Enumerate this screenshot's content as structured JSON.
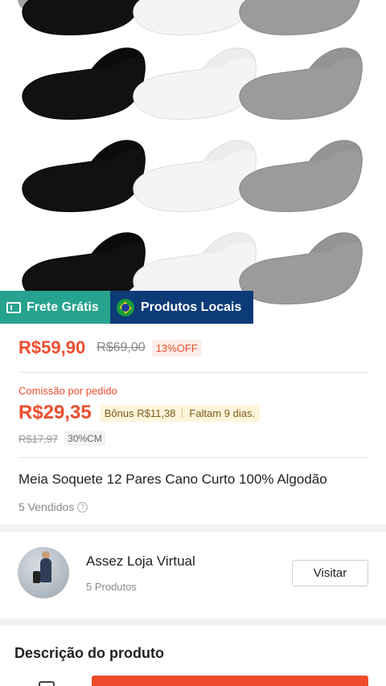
{
  "product": {
    "badges": {
      "free_shipping": "Frete Grátis",
      "local_products": "Produtos Locais"
    },
    "price": "R$59,90",
    "original_price": "R$69,00",
    "discount": "13%OFF",
    "commission": {
      "label": "Comissão por pedido",
      "value": "R$29,35",
      "bonus": "Bônus R$11,38",
      "remaining": "Faltam 9 dias.",
      "old_value": "R$17,97",
      "rate": "30%CM"
    },
    "title": "Meia Soquete 12 Pares Cano Curto 100% Algodão",
    "sold": "5 Vendidos"
  },
  "shop": {
    "name": "Assez Loja Virtual",
    "products": "5 Produtos",
    "visit_label": "Visitar"
  },
  "description": {
    "title": "Descrição do produto"
  },
  "colors": {
    "accent": "#ee4d2d",
    "free_shipping_bg": "#26a38e",
    "local_bg": "#0d3b78",
    "sock_black": "#111111",
    "sock_white": "#f4f4f6",
    "sock_gray": "#9b9b9b"
  }
}
